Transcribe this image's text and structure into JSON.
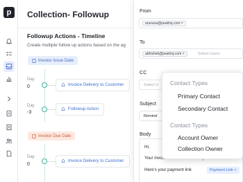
{
  "app": {
    "logo_letter": "p"
  },
  "sidebar": {
    "items": [
      {
        "icon": "bell-icon"
      },
      {
        "icon": "checklist-icon"
      },
      {
        "icon": "inbox-icon",
        "active": true
      },
      {
        "icon": "bar-chart-icon"
      },
      {
        "icon": "chevron-right-icon"
      },
      {
        "icon": "document-icon"
      },
      {
        "icon": "receipt-icon"
      },
      {
        "icon": "users-icon"
      },
      {
        "icon": "file-icon"
      }
    ]
  },
  "page": {
    "title": "Collection-  Followup",
    "section_title": "Followup Actions - Timeline",
    "section_subtitle": "Create multiple follow up actions based on the ag"
  },
  "timeline": {
    "triggers": [
      {
        "label": "Invoice Issue Date",
        "color": "#e7eefc"
      },
      {
        "label": "Invoice Due Date",
        "color": "#fde8e0"
      }
    ],
    "steps": [
      {
        "day_label": "Day",
        "day_value": "0",
        "action": "Invoice Delivery to Customer"
      },
      {
        "day_label": "Day",
        "day_value": "-3",
        "action": "Followup Action"
      },
      {
        "day_label": "Day",
        "day_value": "0",
        "action": "Invoice Delivery to Customer"
      }
    ]
  },
  "compose": {
    "from_label": "From",
    "from_value": "arunava@peakhq.com",
    "to_label": "To",
    "to_value": "abhishek@peakhq.com",
    "to_placeholder": "Select Users",
    "cc_label": "CC",
    "cc_placeholder": "Select U",
    "subject_label": "Subject",
    "subject_value": "Remind",
    "body_label": "Body",
    "body_greeting": "Hi,",
    "body_line2": "Your invoice is due. Please Pay before",
    "body_line3": "Here's your payment link",
    "payment_chip": "Payment Link"
  },
  "dropdown": {
    "groups": [
      {
        "header": "Contact Types",
        "items": [
          "Primary Contact",
          "Secondary Contact"
        ]
      },
      {
        "header": "Contact Types",
        "items": [
          "Account Owner",
          "Collection Owner"
        ]
      }
    ]
  },
  "colors": {
    "accent": "#3a6fd0",
    "timeline_green": "#3db39a"
  }
}
